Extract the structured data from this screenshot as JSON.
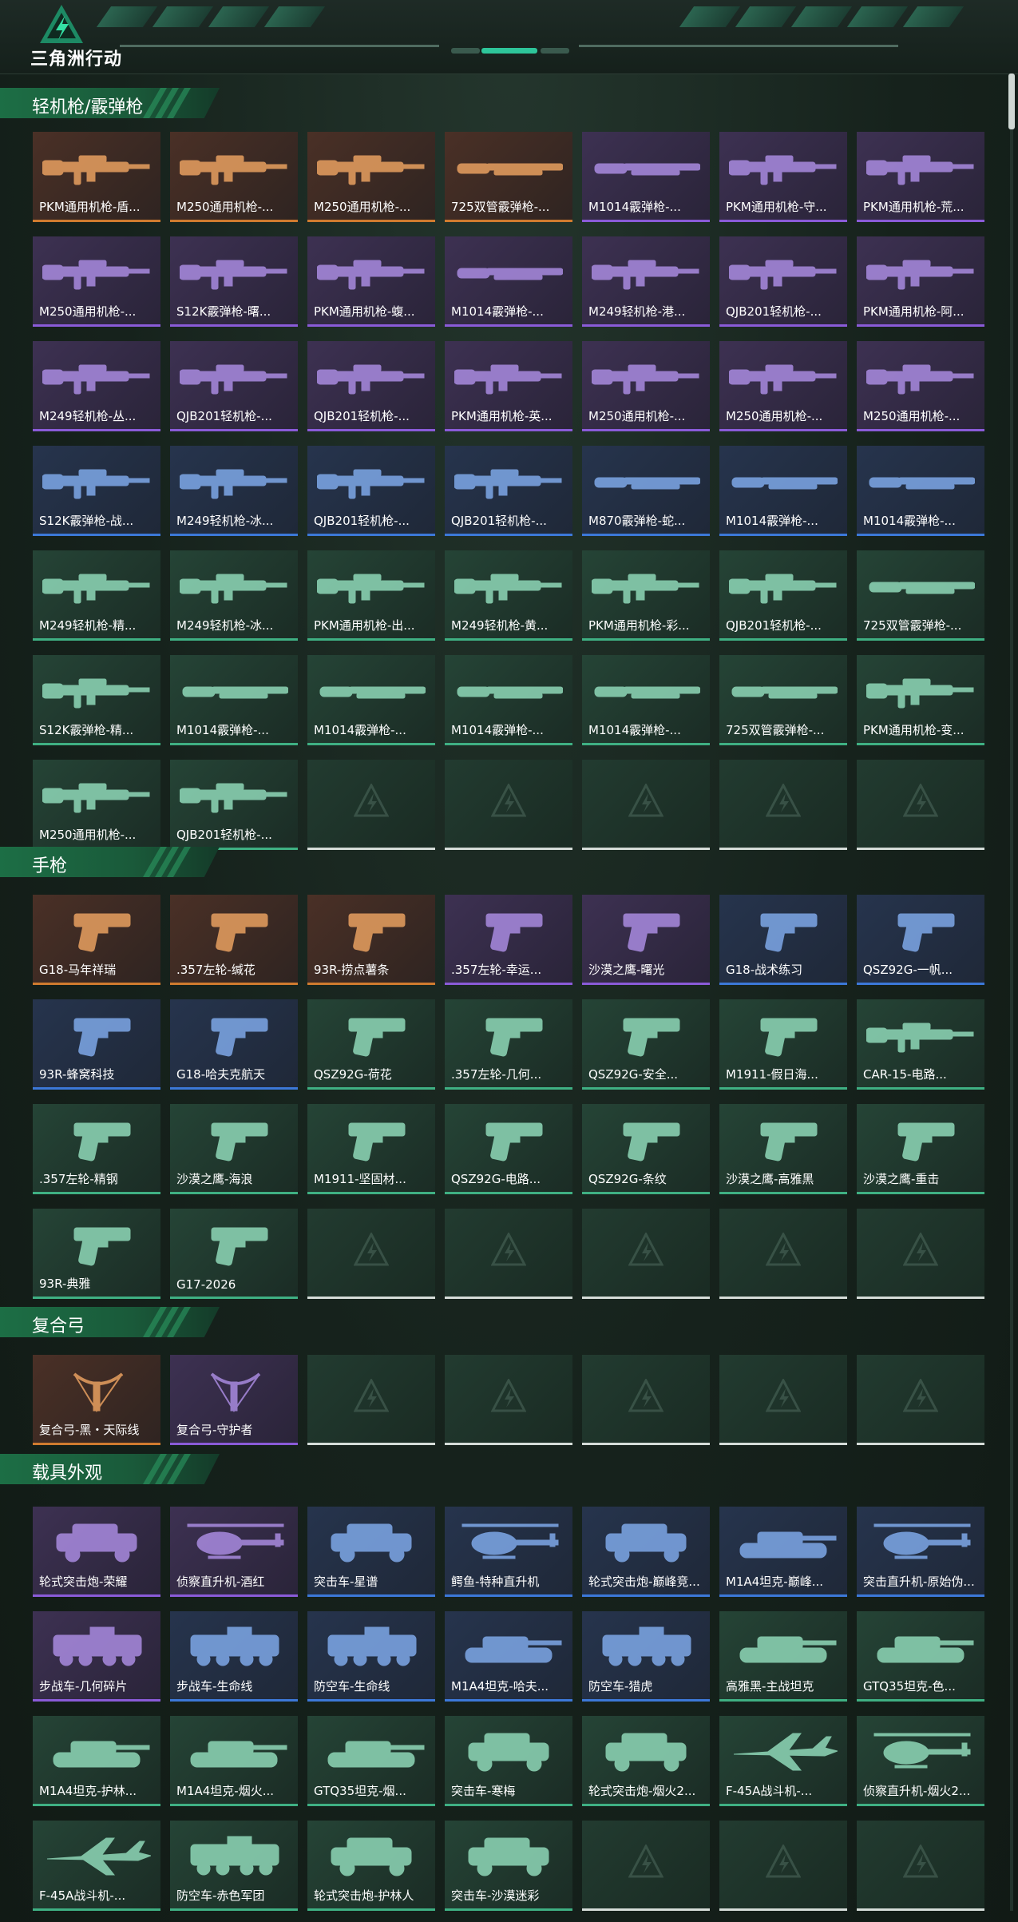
{
  "brand": "三角洲行动",
  "sections": [
    {
      "id": "lmg",
      "title": "轻机枪/霰弹枪",
      "items": [
        {
          "label": "PKM通用机枪-盾...",
          "tier": "orange",
          "kind": "rifle"
        },
        {
          "label": "M250通用机枪-...",
          "tier": "orange",
          "kind": "rifle"
        },
        {
          "label": "M250通用机枪-...",
          "tier": "orange",
          "kind": "rifle"
        },
        {
          "label": "725双管霰弹枪-...",
          "tier": "orange",
          "kind": "shotgun"
        },
        {
          "label": "M1014霰弹枪-...",
          "tier": "purple",
          "kind": "shotgun"
        },
        {
          "label": "PKM通用机枪-守...",
          "tier": "purple",
          "kind": "rifle"
        },
        {
          "label": "PKM通用机枪-荒...",
          "tier": "purple",
          "kind": "rifle"
        },
        {
          "label": "M250通用机枪-...",
          "tier": "purple",
          "kind": "rifle"
        },
        {
          "label": "S12K霰弹枪-曙...",
          "tier": "purple",
          "kind": "rifle"
        },
        {
          "label": "PKM通用机枪-蝮...",
          "tier": "purple",
          "kind": "rifle"
        },
        {
          "label": "M1014霰弹枪-...",
          "tier": "purple",
          "kind": "shotgun"
        },
        {
          "label": "M249轻机枪-港...",
          "tier": "purple",
          "kind": "rifle"
        },
        {
          "label": "QJB201轻机枪-...",
          "tier": "purple",
          "kind": "rifle"
        },
        {
          "label": "PKM通用机枪-阿...",
          "tier": "purple",
          "kind": "rifle"
        },
        {
          "label": "M249轻机枪-丛...",
          "tier": "purple",
          "kind": "rifle"
        },
        {
          "label": "QJB201轻机枪-...",
          "tier": "purple",
          "kind": "rifle"
        },
        {
          "label": "QJB201轻机枪-...",
          "tier": "purple",
          "kind": "rifle"
        },
        {
          "label": "PKM通用机枪-英...",
          "tier": "purple",
          "kind": "rifle"
        },
        {
          "label": "M250通用机枪-...",
          "tier": "purple",
          "kind": "rifle"
        },
        {
          "label": "M250通用机枪-...",
          "tier": "purple",
          "kind": "rifle"
        },
        {
          "label": "M250通用机枪-...",
          "tier": "purple",
          "kind": "rifle"
        },
        {
          "label": "S12K霰弹枪-战...",
          "tier": "blue",
          "kind": "rifle"
        },
        {
          "label": "M249轻机枪-冰...",
          "tier": "blue",
          "kind": "rifle"
        },
        {
          "label": "QJB201轻机枪-...",
          "tier": "blue",
          "kind": "rifle"
        },
        {
          "label": "QJB201轻机枪-...",
          "tier": "blue",
          "kind": "rifle"
        },
        {
          "label": "M870霰弹枪-蛇...",
          "tier": "blue",
          "kind": "shotgun"
        },
        {
          "label": "M1014霰弹枪-...",
          "tier": "blue",
          "kind": "shotgun"
        },
        {
          "label": "M1014霰弹枪-...",
          "tier": "blue",
          "kind": "shotgun"
        },
        {
          "label": "M249轻机枪-精...",
          "tier": "green",
          "kind": "rifle"
        },
        {
          "label": "M249轻机枪-冰...",
          "tier": "green",
          "kind": "rifle"
        },
        {
          "label": "PKM通用机枪-出...",
          "tier": "green",
          "kind": "rifle"
        },
        {
          "label": "M249轻机枪-黄...",
          "tier": "green",
          "kind": "rifle"
        },
        {
          "label": "PKM通用机枪-彩...",
          "tier": "green",
          "kind": "rifle"
        },
        {
          "label": "QJB201轻机枪-...",
          "tier": "green",
          "kind": "rifle"
        },
        {
          "label": "725双管霰弹枪-...",
          "tier": "green",
          "kind": "shotgun"
        },
        {
          "label": "S12K霰弹枪-精...",
          "tier": "green",
          "kind": "rifle"
        },
        {
          "label": "M1014霰弹枪-...",
          "tier": "green",
          "kind": "shotgun"
        },
        {
          "label": "M1014霰弹枪-...",
          "tier": "green",
          "kind": "shotgun"
        },
        {
          "label": "M1014霰弹枪-...",
          "tier": "green",
          "kind": "shotgun"
        },
        {
          "label": "M1014霰弹枪-...",
          "tier": "green",
          "kind": "shotgun"
        },
        {
          "label": "725双管霰弹枪-...",
          "tier": "green",
          "kind": "shotgun"
        },
        {
          "label": "PKM通用机枪-变...",
          "tier": "green",
          "kind": "rifle"
        },
        {
          "label": "M250通用机枪-...",
          "tier": "green",
          "kind": "rifle"
        },
        {
          "label": "QJB201轻机枪-...",
          "tier": "green",
          "kind": "rifle"
        },
        {
          "label": "",
          "tier": "empty"
        },
        {
          "label": "",
          "tier": "empty"
        },
        {
          "label": "",
          "tier": "empty"
        },
        {
          "label": "",
          "tier": "empty"
        },
        {
          "label": "",
          "tier": "empty"
        }
      ]
    },
    {
      "id": "pistol",
      "title": "手枪",
      "items": [
        {
          "label": "G18-马年祥瑞",
          "tier": "orange",
          "kind": "pistol"
        },
        {
          "label": ".357左轮-缄花",
          "tier": "orange",
          "kind": "pistol"
        },
        {
          "label": "93R-捞点薯条",
          "tier": "orange",
          "kind": "pistol"
        },
        {
          "label": ".357左轮-幸运...",
          "tier": "purple",
          "kind": "pistol"
        },
        {
          "label": "沙漠之鹰-曙光",
          "tier": "purple",
          "kind": "pistol"
        },
        {
          "label": "G18-战术练习",
          "tier": "blue",
          "kind": "pistol"
        },
        {
          "label": "QSZ92G-一帆...",
          "tier": "blue",
          "kind": "pistol"
        },
        {
          "label": "93R-蜂窝科技",
          "tier": "blue",
          "kind": "pistol"
        },
        {
          "label": "G18-哈夫克航天",
          "tier": "blue",
          "kind": "pistol"
        },
        {
          "label": "QSZ92G-荷花",
          "tier": "green",
          "kind": "pistol"
        },
        {
          "label": ".357左轮-几何...",
          "tier": "green",
          "kind": "pistol"
        },
        {
          "label": "QSZ92G-安全...",
          "tier": "green",
          "kind": "pistol"
        },
        {
          "label": "M1911-假日海...",
          "tier": "green",
          "kind": "pistol"
        },
        {
          "label": "CAR-15-电路...",
          "tier": "green",
          "kind": "rifle"
        },
        {
          "label": ".357左轮-精钢",
          "tier": "green",
          "kind": "pistol"
        },
        {
          "label": "沙漠之鹰-海浪",
          "tier": "green",
          "kind": "pistol"
        },
        {
          "label": "M1911-坚固材...",
          "tier": "green",
          "kind": "pistol"
        },
        {
          "label": "QSZ92G-电路...",
          "tier": "green",
          "kind": "pistol"
        },
        {
          "label": "QSZ92G-条纹",
          "tier": "green",
          "kind": "pistol"
        },
        {
          "label": "沙漠之鹰-高雅黑",
          "tier": "green",
          "kind": "pistol"
        },
        {
          "label": "沙漠之鹰-重击",
          "tier": "green",
          "kind": "pistol"
        },
        {
          "label": "93R-典雅",
          "tier": "green",
          "kind": "pistol"
        },
        {
          "label": "G17-2026",
          "tier": "green",
          "kind": "pistol"
        },
        {
          "label": "",
          "tier": "empty"
        },
        {
          "label": "",
          "tier": "empty"
        },
        {
          "label": "",
          "tier": "empty"
        },
        {
          "label": "",
          "tier": "empty"
        },
        {
          "label": "",
          "tier": "empty"
        }
      ]
    },
    {
      "id": "bow",
      "title": "复合弓",
      "items": [
        {
          "label": "复合弓-黑・天际线",
          "tier": "orange",
          "kind": "bow"
        },
        {
          "label": "复合弓-守护者",
          "tier": "purple",
          "kind": "bow"
        },
        {
          "label": "",
          "tier": "empty"
        },
        {
          "label": "",
          "tier": "empty"
        },
        {
          "label": "",
          "tier": "empty"
        },
        {
          "label": "",
          "tier": "empty"
        },
        {
          "label": "",
          "tier": "empty"
        }
      ]
    },
    {
      "id": "vehicle",
      "title": "载具外观",
      "items": [
        {
          "label": "轮式突击炮-荣耀",
          "tier": "purple",
          "kind": "car"
        },
        {
          "label": "侦察直升机-酒红",
          "tier": "purple",
          "kind": "heli"
        },
        {
          "label": "突击车-星谱",
          "tier": "blue",
          "kind": "car"
        },
        {
          "label": "鳄鱼-特种直升机",
          "tier": "blue",
          "kind": "heli"
        },
        {
          "label": "轮式突击炮-巅峰竞...",
          "tier": "blue",
          "kind": "car"
        },
        {
          "label": "M1A4坦克-巅峰...",
          "tier": "blue",
          "kind": "tank"
        },
        {
          "label": "突击直升机-原始伪...",
          "tier": "blue",
          "kind": "heli"
        },
        {
          "label": "步战车-几何碎片",
          "tier": "purple",
          "kind": "apc"
        },
        {
          "label": "步战车-生命线",
          "tier": "blue",
          "kind": "apc"
        },
        {
          "label": "防空车-生命线",
          "tier": "blue",
          "kind": "apc"
        },
        {
          "label": "M1A4坦克-哈夫...",
          "tier": "blue",
          "kind": "tank"
        },
        {
          "label": "防空车-猎虎",
          "tier": "blue",
          "kind": "apc"
        },
        {
          "label": "高雅黑-主战坦克",
          "tier": "green",
          "kind": "tank"
        },
        {
          "label": "GTQ35坦克-色...",
          "tier": "green",
          "kind": "tank"
        },
        {
          "label": "M1A4坦克-护林...",
          "tier": "green",
          "kind": "tank"
        },
        {
          "label": "M1A4坦克-烟火...",
          "tier": "green",
          "kind": "tank"
        },
        {
          "label": "GTQ35坦克-烟...",
          "tier": "green",
          "kind": "tank"
        },
        {
          "label": "突击车-寒梅",
          "tier": "green",
          "kind": "car"
        },
        {
          "label": "轮式突击炮-烟火2...",
          "tier": "green",
          "kind": "car"
        },
        {
          "label": "F-45A战斗机-...",
          "tier": "green",
          "kind": "jet"
        },
        {
          "label": "侦察直升机-烟火2...",
          "tier": "green",
          "kind": "heli"
        },
        {
          "label": "F-45A战斗机-...",
          "tier": "green",
          "kind": "jet"
        },
        {
          "label": "防空车-赤色军团",
          "tier": "green",
          "kind": "apc"
        },
        {
          "label": "轮式突击炮-护林人",
          "tier": "green",
          "kind": "car"
        },
        {
          "label": "突击车-沙漠迷彩",
          "tier": "green",
          "kind": "car"
        },
        {
          "label": "",
          "tier": "empty"
        },
        {
          "label": "",
          "tier": "empty"
        },
        {
          "label": "",
          "tier": "empty"
        }
      ]
    }
  ],
  "colors": {
    "orange": "#d07b2f",
    "purple": "#8a5bd8",
    "blue": "#3c78d8",
    "green": "#3fb083",
    "accent": "#2ec59a"
  }
}
